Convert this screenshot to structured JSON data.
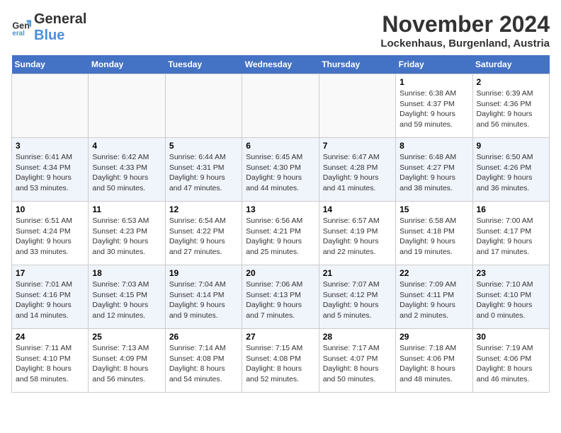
{
  "logo": {
    "general": "General",
    "blue": "Blue"
  },
  "title": "November 2024",
  "subtitle": "Lockenhaus, Burgenland, Austria",
  "days_of_week": [
    "Sunday",
    "Monday",
    "Tuesday",
    "Wednesday",
    "Thursday",
    "Friday",
    "Saturday"
  ],
  "weeks": [
    [
      {
        "day": "",
        "info": ""
      },
      {
        "day": "",
        "info": ""
      },
      {
        "day": "",
        "info": ""
      },
      {
        "day": "",
        "info": ""
      },
      {
        "day": "",
        "info": ""
      },
      {
        "day": "1",
        "info": "Sunrise: 6:38 AM\nSunset: 4:37 PM\nDaylight: 9 hours and 59 minutes."
      },
      {
        "day": "2",
        "info": "Sunrise: 6:39 AM\nSunset: 4:36 PM\nDaylight: 9 hours and 56 minutes."
      }
    ],
    [
      {
        "day": "3",
        "info": "Sunrise: 6:41 AM\nSunset: 4:34 PM\nDaylight: 9 hours and 53 minutes."
      },
      {
        "day": "4",
        "info": "Sunrise: 6:42 AM\nSunset: 4:33 PM\nDaylight: 9 hours and 50 minutes."
      },
      {
        "day": "5",
        "info": "Sunrise: 6:44 AM\nSunset: 4:31 PM\nDaylight: 9 hours and 47 minutes."
      },
      {
        "day": "6",
        "info": "Sunrise: 6:45 AM\nSunset: 4:30 PM\nDaylight: 9 hours and 44 minutes."
      },
      {
        "day": "7",
        "info": "Sunrise: 6:47 AM\nSunset: 4:28 PM\nDaylight: 9 hours and 41 minutes."
      },
      {
        "day": "8",
        "info": "Sunrise: 6:48 AM\nSunset: 4:27 PM\nDaylight: 9 hours and 38 minutes."
      },
      {
        "day": "9",
        "info": "Sunrise: 6:50 AM\nSunset: 4:26 PM\nDaylight: 9 hours and 36 minutes."
      }
    ],
    [
      {
        "day": "10",
        "info": "Sunrise: 6:51 AM\nSunset: 4:24 PM\nDaylight: 9 hours and 33 minutes."
      },
      {
        "day": "11",
        "info": "Sunrise: 6:53 AM\nSunset: 4:23 PM\nDaylight: 9 hours and 30 minutes."
      },
      {
        "day": "12",
        "info": "Sunrise: 6:54 AM\nSunset: 4:22 PM\nDaylight: 9 hours and 27 minutes."
      },
      {
        "day": "13",
        "info": "Sunrise: 6:56 AM\nSunset: 4:21 PM\nDaylight: 9 hours and 25 minutes."
      },
      {
        "day": "14",
        "info": "Sunrise: 6:57 AM\nSunset: 4:19 PM\nDaylight: 9 hours and 22 minutes."
      },
      {
        "day": "15",
        "info": "Sunrise: 6:58 AM\nSunset: 4:18 PM\nDaylight: 9 hours and 19 minutes."
      },
      {
        "day": "16",
        "info": "Sunrise: 7:00 AM\nSunset: 4:17 PM\nDaylight: 9 hours and 17 minutes."
      }
    ],
    [
      {
        "day": "17",
        "info": "Sunrise: 7:01 AM\nSunset: 4:16 PM\nDaylight: 9 hours and 14 minutes."
      },
      {
        "day": "18",
        "info": "Sunrise: 7:03 AM\nSunset: 4:15 PM\nDaylight: 9 hours and 12 minutes."
      },
      {
        "day": "19",
        "info": "Sunrise: 7:04 AM\nSunset: 4:14 PM\nDaylight: 9 hours and 9 minutes."
      },
      {
        "day": "20",
        "info": "Sunrise: 7:06 AM\nSunset: 4:13 PM\nDaylight: 9 hours and 7 minutes."
      },
      {
        "day": "21",
        "info": "Sunrise: 7:07 AM\nSunset: 4:12 PM\nDaylight: 9 hours and 5 minutes."
      },
      {
        "day": "22",
        "info": "Sunrise: 7:09 AM\nSunset: 4:11 PM\nDaylight: 9 hours and 2 minutes."
      },
      {
        "day": "23",
        "info": "Sunrise: 7:10 AM\nSunset: 4:10 PM\nDaylight: 9 hours and 0 minutes."
      }
    ],
    [
      {
        "day": "24",
        "info": "Sunrise: 7:11 AM\nSunset: 4:10 PM\nDaylight: 8 hours and 58 minutes."
      },
      {
        "day": "25",
        "info": "Sunrise: 7:13 AM\nSunset: 4:09 PM\nDaylight: 8 hours and 56 minutes."
      },
      {
        "day": "26",
        "info": "Sunrise: 7:14 AM\nSunset: 4:08 PM\nDaylight: 8 hours and 54 minutes."
      },
      {
        "day": "27",
        "info": "Sunrise: 7:15 AM\nSunset: 4:08 PM\nDaylight: 8 hours and 52 minutes."
      },
      {
        "day": "28",
        "info": "Sunrise: 7:17 AM\nSunset: 4:07 PM\nDaylight: 8 hours and 50 minutes."
      },
      {
        "day": "29",
        "info": "Sunrise: 7:18 AM\nSunset: 4:06 PM\nDaylight: 8 hours and 48 minutes."
      },
      {
        "day": "30",
        "info": "Sunrise: 7:19 AM\nSunset: 4:06 PM\nDaylight: 8 hours and 46 minutes."
      }
    ]
  ]
}
